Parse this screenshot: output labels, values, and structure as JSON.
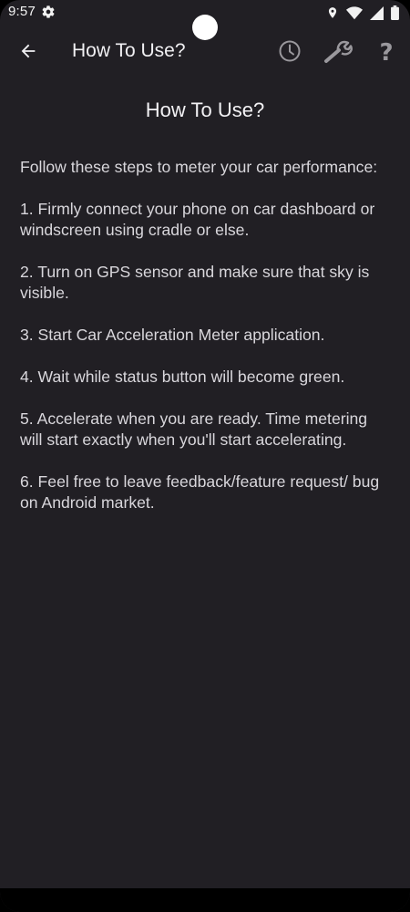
{
  "status_bar": {
    "time": "9:57"
  },
  "app_bar": {
    "title": "How To Use?",
    "help_glyph": "?"
  },
  "content": {
    "heading": "How To Use?",
    "paragraphs": [
      "Follow these steps to meter your car performance:",
      "1. Firmly connect your phone on car dashboard or windscreen using cradle or else.",
      "2. Turn on GPS sensor and make sure that sky is visible.",
      "3. Start Car Acceleration Meter application.",
      "4. Wait while status button will become green.",
      "5. Accelerate when you are ready. Time metering will start exactly when you'll start accelerating.",
      "6. Feel free to leave feedback/feature request/ bug on Android market."
    ]
  },
  "icons": {
    "status_settings": "gear-icon",
    "status_location": "location-icon",
    "status_wifi": "wifi-icon",
    "status_signal": "signal-icon",
    "status_battery": "battery-icon",
    "back": "arrow-back-icon",
    "history": "clock-icon",
    "settings": "wrench-icon",
    "help": "question-mark-icon"
  },
  "colors": {
    "background": "#211f24",
    "text": "#d9d7dc",
    "icon": "#9a989d"
  }
}
